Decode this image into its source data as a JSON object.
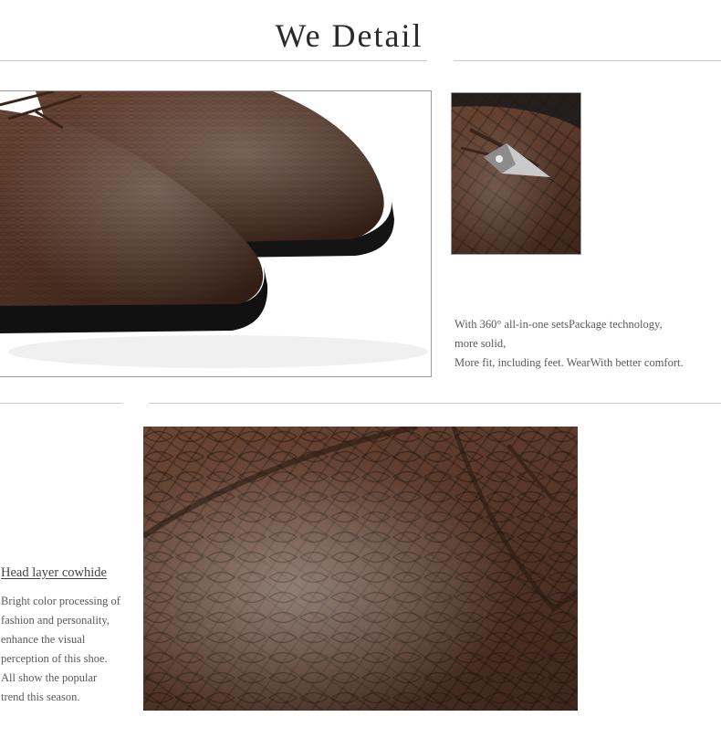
{
  "header": {
    "title": "We Detail"
  },
  "detail_top": {
    "lines": [
      "With 360°  all-in-one setsPackage technology,",
      "more solid,",
      "More fit, including feet. WearWith better comfort."
    ]
  },
  "detail_bottom": {
    "heading": "Head layer cowhide",
    "lines": [
      "Bright color processing of",
      "fashion and personality,",
      "enhance the visual",
      "perception of this shoe.",
      "All show the popular",
      "trend this season."
    ]
  },
  "images": {
    "main_image": "brown crocodile-pattern leather dress shoes, side view",
    "hardware_image": "silver metal lace tip on leather upper",
    "closeup_image": "close-up of crocodile-embossed leather toe"
  }
}
